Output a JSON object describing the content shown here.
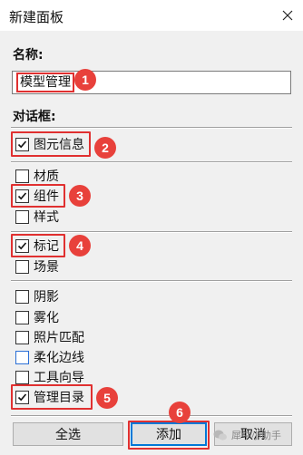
{
  "window": {
    "title": "新建面板"
  },
  "name_section": {
    "label": "名称:",
    "value": "模型管理"
  },
  "dialog_section": {
    "label": "对话框:"
  },
  "groups": [
    {
      "items": [
        {
          "label": "图元信息",
          "checked": true
        }
      ]
    },
    {
      "items": [
        {
          "label": "材质",
          "checked": false
        },
        {
          "label": "组件",
          "checked": true
        },
        {
          "label": "样式",
          "checked": false
        }
      ]
    },
    {
      "items": [
        {
          "label": "标记",
          "checked": true
        },
        {
          "label": "场景",
          "checked": false
        }
      ]
    },
    {
      "items": [
        {
          "label": "阴影",
          "checked": false
        },
        {
          "label": "雾化",
          "checked": false
        },
        {
          "label": "照片匹配",
          "checked": false
        },
        {
          "label": "柔化边线",
          "checked": false
        },
        {
          "label": "工具向导",
          "checked": false
        },
        {
          "label": "管理目录",
          "checked": true
        }
      ]
    }
  ],
  "buttons": {
    "select_all": "全选",
    "add": "添加",
    "cancel": "取消"
  },
  "badges": [
    "1",
    "2",
    "3",
    "4",
    "5",
    "6"
  ],
  "watermark": {
    "text": "犀牛小助手"
  },
  "colors": {
    "highlight": "#e03030",
    "badge": "#e8413b",
    "focus": "#0078d7"
  }
}
